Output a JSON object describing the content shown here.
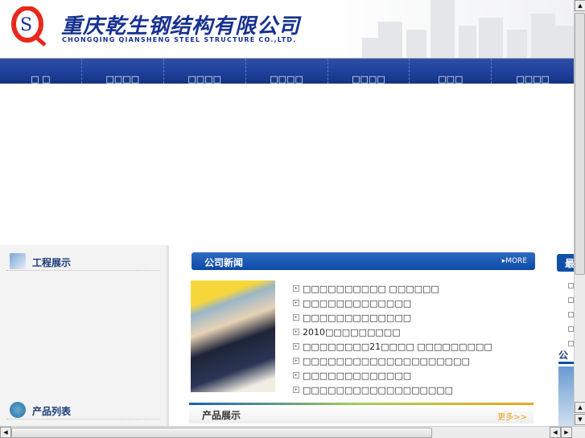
{
  "header": {
    "logo_cn": "重庆乾生钢结构有限公司",
    "logo_en": "CHONGQING QIANSHENG STEEL STRUCTURE CO.,LTD.",
    "logo_mark": "QS"
  },
  "nav": [
    "□ □",
    "□□□□",
    "□□□□",
    "□□□□",
    "□□□□",
    "□□□",
    "□□□□"
  ],
  "left": {
    "projects": "工程展示",
    "products": "产品列表"
  },
  "news": {
    "title": "公司新闻",
    "more": "▸MORE",
    "items": [
      "□□□□□□□□□□ □□□□□□",
      "□□□□□□□□□□□□□",
      "□□□□□□□□□□□□□",
      "2010□□□□□□□□□",
      "□□□□□□□□21□□□□ □□□□□□□□□",
      "□□□□□□□□□□□□□□□□□□□□",
      "□□□□□□□□□□□□□",
      "□□□□□□□□□□□□□□□□□□"
    ]
  },
  "products": {
    "title": "产品展示",
    "more": "更多>>"
  },
  "right": {
    "bar": "最",
    "head": "公"
  }
}
